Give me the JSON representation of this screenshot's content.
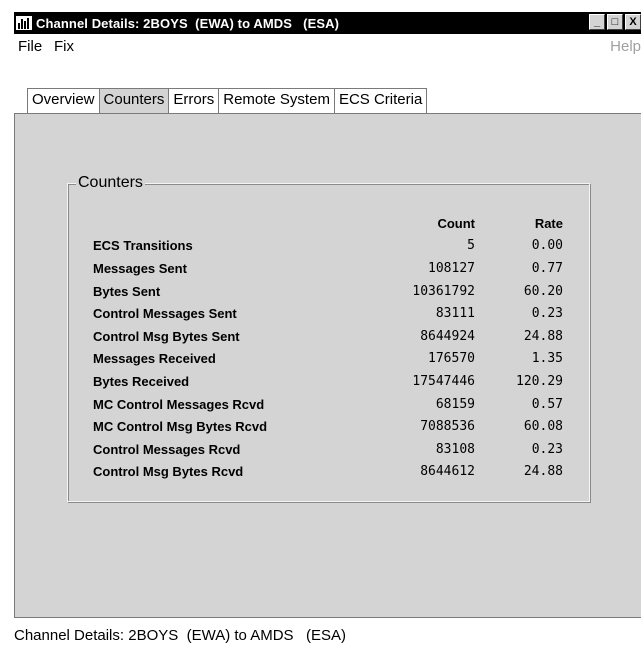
{
  "window": {
    "title": "Channel Details: 2BOYS  (EWA) to AMDS   (ESA)",
    "buttons": {
      "minimize": "_",
      "maximize": "□",
      "close": "X"
    }
  },
  "menubar": {
    "file": "File",
    "fix": "Fix",
    "help": "Help"
  },
  "tabs": [
    {
      "label": "Overview"
    },
    {
      "label": "Counters"
    },
    {
      "label": "Errors"
    },
    {
      "label": "Remote System"
    },
    {
      "label": "ECS Criteria"
    }
  ],
  "counters": {
    "group_title": "Counters",
    "header_count": "Count",
    "header_rate": "Rate",
    "rows": [
      {
        "label": "ECS Transitions",
        "count": "5",
        "rate": "0.00"
      },
      {
        "label": "Messages Sent",
        "count": "108127",
        "rate": "0.77"
      },
      {
        "label": "Bytes Sent",
        "count": "10361792",
        "rate": "60.20"
      },
      {
        "label": "Control Messages Sent",
        "count": "83111",
        "rate": "0.23"
      },
      {
        "label": "Control Msg Bytes Sent",
        "count": "8644924",
        "rate": "24.88"
      },
      {
        "label": "Messages Received",
        "count": "176570",
        "rate": "1.35"
      },
      {
        "label": "Bytes Received",
        "count": "17547446",
        "rate": "120.29"
      },
      {
        "label": "MC Control Messages Rcvd",
        "count": "68159",
        "rate": "0.57"
      },
      {
        "label": "MC Control Msg Bytes Rcvd",
        "count": "7088536",
        "rate": "60.08"
      },
      {
        "label": "Control Messages Rcvd",
        "count": "83108",
        "rate": "0.23"
      },
      {
        "label": "Control Msg Bytes Rcvd",
        "count": "8644612",
        "rate": "24.88"
      }
    ]
  },
  "status": {
    "text": "Channel Details: 2BOYS  (EWA) to AMDS   (ESA)"
  }
}
